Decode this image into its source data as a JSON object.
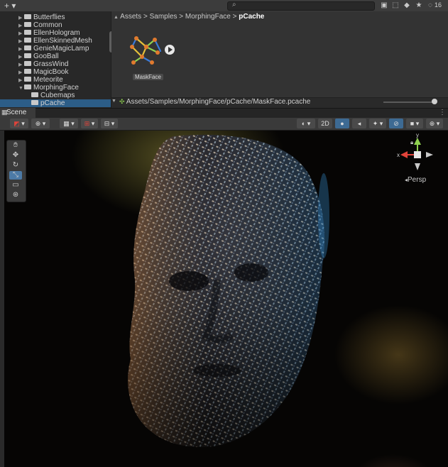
{
  "project_bar": {
    "plus_label": "+ ▾",
    "search": {
      "placeholder": ""
    },
    "hidden_count": "16",
    "icons": [
      "search-icon",
      "layers-icon",
      "tag-icon",
      "star-icon",
      "eye-slash-icon"
    ]
  },
  "project_tree": {
    "items": [
      {
        "label": "Butterflies",
        "expanded": false,
        "selected": false
      },
      {
        "label": "Common",
        "expanded": false,
        "selected": false
      },
      {
        "label": "EllenHologram",
        "expanded": false,
        "selected": false
      },
      {
        "label": "EllenSkinnedMesh",
        "expanded": false,
        "selected": false
      },
      {
        "label": "GenieMagicLamp",
        "expanded": false,
        "selected": false
      },
      {
        "label": "GooBall",
        "expanded": false,
        "selected": false
      },
      {
        "label": "GrassWind",
        "expanded": false,
        "selected": false
      },
      {
        "label": "MagicBook",
        "expanded": false,
        "selected": false
      },
      {
        "label": "Meteorite",
        "expanded": false,
        "selected": false
      },
      {
        "label": "MorphingFace",
        "expanded": true,
        "selected": false
      },
      {
        "label": "Cubemaps",
        "expanded": false,
        "selected": false
      },
      {
        "label": "pCache",
        "expanded": false,
        "selected": true
      }
    ]
  },
  "breadcrumb": {
    "items": [
      "Assets",
      "Samples",
      "MorphingFace"
    ],
    "current": "pCache",
    "separator": ">"
  },
  "assets": [
    {
      "name": "MaskFace"
    }
  ],
  "path_bar": {
    "path": "Assets/Samples/MorphingFace/pCache/MaskFace.pcache"
  },
  "scene": {
    "tab_label": "Scene",
    "toolbar": {
      "two_d_label": "2D"
    },
    "gizmo": {
      "x_label": "x",
      "y_label": "y",
      "projection": "Persp"
    }
  },
  "colors": {
    "selection": "#2c5d87",
    "accent": "#3d6a93",
    "axis_x": "#e0433a",
    "axis_y": "#8fd14f",
    "axis_z": "#3a7ad8"
  }
}
